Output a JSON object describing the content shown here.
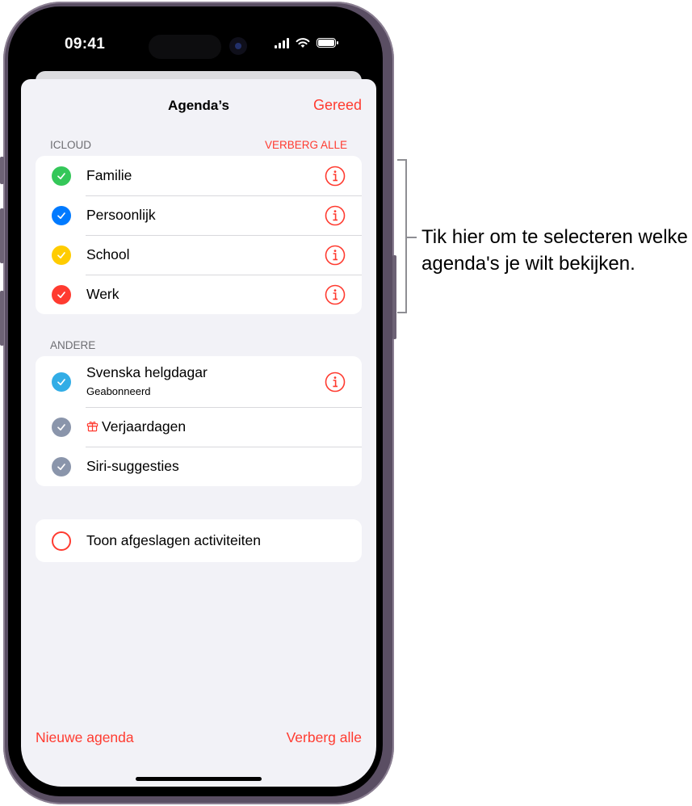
{
  "status_bar": {
    "time": "09:41",
    "icons": [
      "cellular-signal-icon",
      "wifi-icon",
      "battery-icon"
    ]
  },
  "nav": {
    "title": "Agenda’s",
    "done_label": "Gereed"
  },
  "sections": [
    {
      "header": "ICLOUD",
      "action_label": "VERBERG ALLE",
      "items": [
        {
          "label": "Familie",
          "checked": true,
          "color": "#34c759",
          "has_info": true
        },
        {
          "label": "Persoonlijk",
          "checked": true,
          "color": "#007aff",
          "has_info": true
        },
        {
          "label": "School",
          "checked": true,
          "color": "#ffcc00",
          "has_info": true
        },
        {
          "label": "Werk",
          "checked": true,
          "color": "#ff3b30",
          "has_info": true
        }
      ]
    },
    {
      "header": "ANDERE",
      "items": [
        {
          "label": "Svenska helgdagar",
          "sublabel": "Geabonneerd",
          "checked": true,
          "color": "#32ade6",
          "has_info": true
        },
        {
          "label": "Verjaardagen",
          "icon": "gift-icon",
          "checked": true,
          "color": "#8a95ab",
          "has_info": false
        },
        {
          "label": "Siri-suggesties",
          "checked": true,
          "color": "#8a95ab",
          "has_info": false
        }
      ]
    }
  ],
  "declined": {
    "label": "Toon afgeslagen activiteiten",
    "checked": false,
    "color": "#ff3b30"
  },
  "toolbar": {
    "new_calendar_label": "Nieuwe agenda",
    "hide_all_label": "Verberg alle"
  },
  "colors": {
    "accent": "#ff3b30",
    "background": "#f2f2f7",
    "secondary_text": "#6d6d72"
  },
  "callout": {
    "text": "Tik hier om te selecteren welke agenda's je wilt bekijken."
  }
}
